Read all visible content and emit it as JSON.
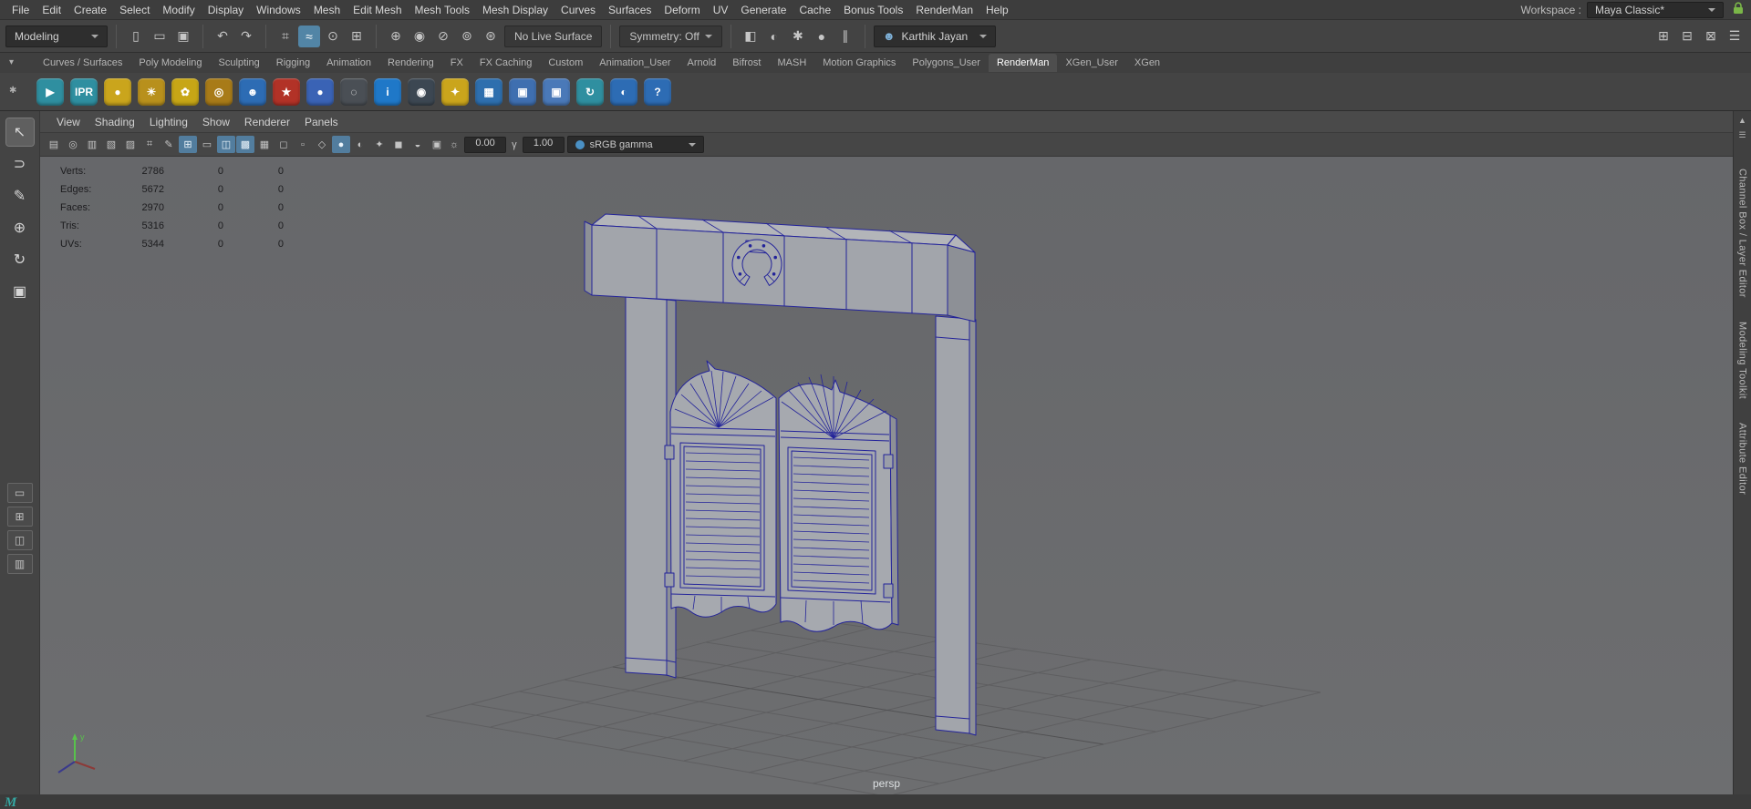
{
  "menubar": {
    "items": [
      "File",
      "Edit",
      "Create",
      "Select",
      "Modify",
      "Display",
      "Windows",
      "Mesh",
      "Edit Mesh",
      "Mesh Tools",
      "Mesh Display",
      "Curves",
      "Surfaces",
      "Deform",
      "UV",
      "Generate",
      "Cache",
      "Bonus Tools",
      "RenderMan",
      "Help"
    ],
    "workspace_label": "Workspace :",
    "workspace_value": "Maya Classic*"
  },
  "toolbar": {
    "mode": "Modeling",
    "no_live_surface": "No Live Surface",
    "symmetry": "Symmetry: Off",
    "user_name": "Karthik Jayan",
    "file_icons": [
      {
        "name": "new-scene-icon",
        "glyph": "▯",
        "active": ""
      },
      {
        "name": "open-scene-icon",
        "glyph": "▭",
        "active": ""
      },
      {
        "name": "save-scene-icon",
        "glyph": "▣",
        "active": ""
      }
    ],
    "history_icons": [
      {
        "name": "undo-icon",
        "glyph": "↶",
        "active": ""
      },
      {
        "name": "redo-icon",
        "glyph": "↷",
        "active": ""
      }
    ],
    "snap_icons": [
      {
        "name": "snap-to-grid-icon",
        "glyph": "⌗",
        "active": ""
      },
      {
        "name": "snap-to-curve-icon",
        "glyph": "≈",
        "active": "1"
      },
      {
        "name": "snap-to-point-icon",
        "glyph": "⊙",
        "active": ""
      },
      {
        "name": "snap-to-plane-icon",
        "glyph": "⊞",
        "active": ""
      }
    ],
    "construction_icons": [
      {
        "name": "snap-together-icon",
        "glyph": "⊕",
        "active": ""
      },
      {
        "name": "make-live-icon",
        "glyph": "◉",
        "active": ""
      },
      {
        "name": "selection-mask-icon",
        "glyph": "⊘",
        "active": ""
      },
      {
        "name": "highlight-selection-icon",
        "glyph": "⊚",
        "active": ""
      },
      {
        "name": "input-operations-icon",
        "glyph": "⊛",
        "active": ""
      }
    ],
    "render_icons": [
      {
        "name": "render-view-icon",
        "glyph": "◧",
        "active": ""
      },
      {
        "name": "ipr-render-icon",
        "glyph": "◐",
        "active": ""
      },
      {
        "name": "render-settings-icon",
        "glyph": "✱",
        "active": ""
      },
      {
        "name": "texture-ball-icon",
        "glyph": "●",
        "active": ""
      },
      {
        "name": "pause-icon",
        "glyph": "∥",
        "active": ""
      }
    ],
    "right_icons": [
      {
        "name": "object-details-icon",
        "glyph": "⊞",
        "active": ""
      },
      {
        "name": "pose-editor-icon",
        "glyph": "⊟",
        "active": ""
      },
      {
        "name": "graph-editor-icon",
        "glyph": "⊠",
        "active": ""
      },
      {
        "name": "outliner-toggle-icon",
        "glyph": "☰",
        "active": ""
      }
    ]
  },
  "shelf": {
    "menu_icon_glyph": "▾",
    "gear_icon_glyph": "✱",
    "tabs": [
      {
        "label": "Curves / Surfaces",
        "active": ""
      },
      {
        "label": "Poly Modeling",
        "active": ""
      },
      {
        "label": "Sculpting",
        "active": ""
      },
      {
        "label": "Rigging",
        "active": ""
      },
      {
        "label": "Animation",
        "active": ""
      },
      {
        "label": "Rendering",
        "active": ""
      },
      {
        "label": "FX",
        "active": ""
      },
      {
        "label": "FX Caching",
        "active": ""
      },
      {
        "label": "Custom",
        "active": ""
      },
      {
        "label": "Animation_User",
        "active": ""
      },
      {
        "label": "Arnold",
        "active": ""
      },
      {
        "label": "Bifrost",
        "active": ""
      },
      {
        "label": "MASH",
        "active": ""
      },
      {
        "label": "Motion Graphics",
        "active": ""
      },
      {
        "label": "Polygons_User",
        "active": ""
      },
      {
        "label": "RenderMan",
        "active": "1"
      },
      {
        "label": "XGen_User",
        "active": ""
      },
      {
        "label": "XGen",
        "active": ""
      }
    ],
    "icons": [
      {
        "name": "renderman-render-icon",
        "glyph": "▶",
        "bg": "#2f8fa0"
      },
      {
        "name": "renderman-ipr-icon",
        "glyph": "IPR",
        "bg": "#2f8fa0"
      },
      {
        "name": "preview-sphere-icon",
        "glyph": "●",
        "bg": "#caa51c"
      },
      {
        "name": "sun-light-icon",
        "glyph": "☀",
        "bg": "#b8901c"
      },
      {
        "name": "flower-shader-icon",
        "glyph": "✿",
        "bg": "#c7a616"
      },
      {
        "name": "gold-material-icon",
        "glyph": "◎",
        "bg": "#a87b18"
      },
      {
        "name": "character-light-icon",
        "glyph": "☻",
        "bg": "#2d6cb4"
      },
      {
        "name": "star-burst-icon",
        "glyph": "★",
        "bg": "#b23227"
      },
      {
        "name": "blue-sphere-icon",
        "glyph": "●",
        "bg": "#3a63b5"
      },
      {
        "name": "selection-ring-icon",
        "glyph": "◌",
        "bg": "#4a4f55"
      },
      {
        "name": "info-icon",
        "glyph": "i",
        "bg": "#1f78c8"
      },
      {
        "name": "inspect-eye-icon",
        "glyph": "◉",
        "bg": "#3c4752"
      },
      {
        "name": "light-bulb-icon",
        "glyph": "✦",
        "bg": "#caa51c"
      },
      {
        "name": "lpe-table-icon",
        "glyph": "▦",
        "bg": "#2e6fae"
      },
      {
        "name": "image-tool-icon",
        "glyph": "▣",
        "bg": "#3f6fb0"
      },
      {
        "name": "image-display-icon",
        "glyph": "▣",
        "bg": "#4a79b8"
      },
      {
        "name": "refresh-orbit-icon",
        "glyph": "↻",
        "bg": "#2f8fa0"
      },
      {
        "name": "swirl-sphere-icon",
        "glyph": "◐",
        "bg": "#2d6cb4"
      },
      {
        "name": "help-icon",
        "glyph": "?",
        "bg": "#2d6cb4"
      }
    ]
  },
  "toolbox": {
    "tools": [
      {
        "name": "select-tool-icon",
        "glyph": "↖",
        "active": "1"
      },
      {
        "name": "lasso-tool-icon",
        "glyph": "⊃",
        "active": ""
      },
      {
        "name": "paint-select-tool-icon",
        "glyph": "✎",
        "active": ""
      },
      {
        "name": "move-tool-icon",
        "glyph": "⊕",
        "active": ""
      },
      {
        "name": "rotate-tool-icon",
        "glyph": "↻",
        "active": ""
      },
      {
        "name": "scale-tool-icon",
        "glyph": "▣",
        "active": ""
      }
    ],
    "layouts": [
      {
        "name": "layout-single-pane-icon",
        "glyph": "▭"
      },
      {
        "name": "layout-four-pane-icon",
        "glyph": "⊞"
      },
      {
        "name": "layout-split-pane-icon",
        "glyph": "◫"
      },
      {
        "name": "layout-outliner-icon",
        "glyph": "▥"
      }
    ]
  },
  "viewport": {
    "menu": [
      "View",
      "Shading",
      "Lighting",
      "Show",
      "Renderer",
      "Panels"
    ],
    "toolbar_icons": [
      {
        "name": "select-camera-icon",
        "glyph": "▤",
        "active": ""
      },
      {
        "name": "lock-camera-icon",
        "glyph": "◎",
        "active": ""
      },
      {
        "name": "camera-attributes-icon",
        "glyph": "▥",
        "active": ""
      },
      {
        "name": "bookmark-icon",
        "glyph": "▧",
        "active": ""
      },
      {
        "name": "image-plane-icon",
        "glyph": "▨",
        "active": ""
      },
      {
        "name": "pan-zoom-2d-icon",
        "glyph": "⌗",
        "active": ""
      },
      {
        "name": "grease-pencil-icon",
        "glyph": "✎",
        "active": ""
      },
      {
        "name": "grid-toggle-icon",
        "glyph": "⊞",
        "active": "1"
      },
      {
        "name": "film-gate-icon",
        "glyph": "▭",
        "active": ""
      },
      {
        "name": "resolution-gate-icon",
        "glyph": "◫",
        "active": "1"
      },
      {
        "name": "gate-mask-icon",
        "glyph": "▩",
        "active": "1"
      },
      {
        "name": "field-chart-icon",
        "glyph": "▦",
        "active": ""
      },
      {
        "name": "safe-action-icon",
        "glyph": "◻",
        "active": ""
      },
      {
        "name": "safe-title-icon",
        "glyph": "▫",
        "active": ""
      },
      {
        "name": "wireframe-mode-icon",
        "glyph": "◇",
        "active": ""
      },
      {
        "name": "shaded-mode-icon",
        "glyph": "●",
        "active": "1"
      },
      {
        "name": "textured-mode-icon",
        "glyph": "◐",
        "active": ""
      },
      {
        "name": "use-all-lights-icon",
        "glyph": "✦",
        "active": ""
      },
      {
        "name": "shadows-icon",
        "glyph": "◼",
        "active": ""
      },
      {
        "name": "ambient-occlusion-icon",
        "glyph": "◒",
        "active": ""
      },
      {
        "name": "anti-alias-icon",
        "glyph": "▣",
        "active": ""
      }
    ],
    "exposure_icon_glyph": "☼",
    "exposure": "0.00",
    "gamma_icon_glyph": "γ",
    "gamma_value": "1.00",
    "colorspace": "sRGB gamma",
    "camera_label": "persp",
    "hud": [
      {
        "label": "Verts:",
        "value": "2786",
        "c1": "0",
        "c2": "0"
      },
      {
        "label": "Edges:",
        "value": "5672",
        "c1": "0",
        "c2": "0"
      },
      {
        "label": "Faces:",
        "value": "2970",
        "c1": "0",
        "c2": "0"
      },
      {
        "label": "Tris:",
        "value": "5316",
        "c1": "0",
        "c2": "0"
      },
      {
        "label": "UVs:",
        "value": "5344",
        "c1": "0",
        "c2": "0"
      }
    ]
  },
  "right_panel": {
    "tabs": [
      "Channel Box / Layer Editor",
      "Modeling Toolkit",
      "Attribute Editor"
    ]
  },
  "colors": {
    "accent": "#5285a6",
    "wireframe": "#23239a",
    "viewport_bg": "#696a6c"
  }
}
